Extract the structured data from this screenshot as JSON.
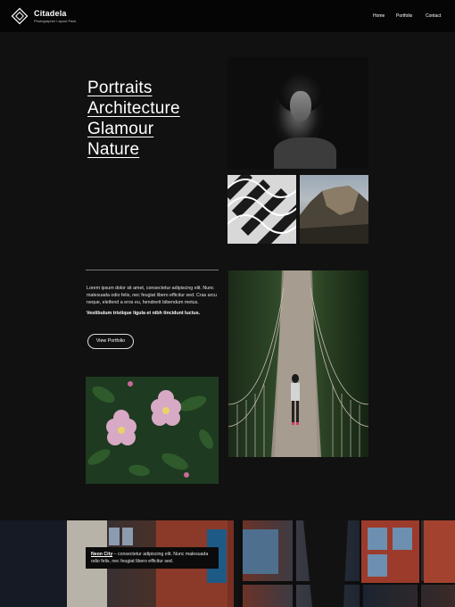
{
  "header": {
    "brand": "Citadela",
    "tagline": "Photographer Layout Pack",
    "logo_icon": "diamond-logo-icon",
    "nav": [
      "Home",
      "Portfolio",
      "Contact"
    ]
  },
  "hero": {
    "lines": [
      "Portraits",
      "Architecture",
      "Glamour",
      "Nature"
    ]
  },
  "intro": {
    "paragraph": "Lorem ipsum dolor sit amet, consectetur adipiscing elit. Nunc malesuada odio felis, nec feugiat libero efficitur sed. Cras arcu neque, eleifend a eros eu, hendrerit bibendum metus.",
    "bold": "Vestibulum tristique ligula et nibh tincidunt luctus.",
    "button_label": "View Portfolio"
  },
  "caption": {
    "title": "Neon City",
    "text": " – consectetur adipiscing elit. Nunc malesuada odio felis, nec feugiat libero efficitur sed."
  },
  "colors": {
    "background": "#111111",
    "header": "#050505",
    "text": "#ffffff"
  }
}
